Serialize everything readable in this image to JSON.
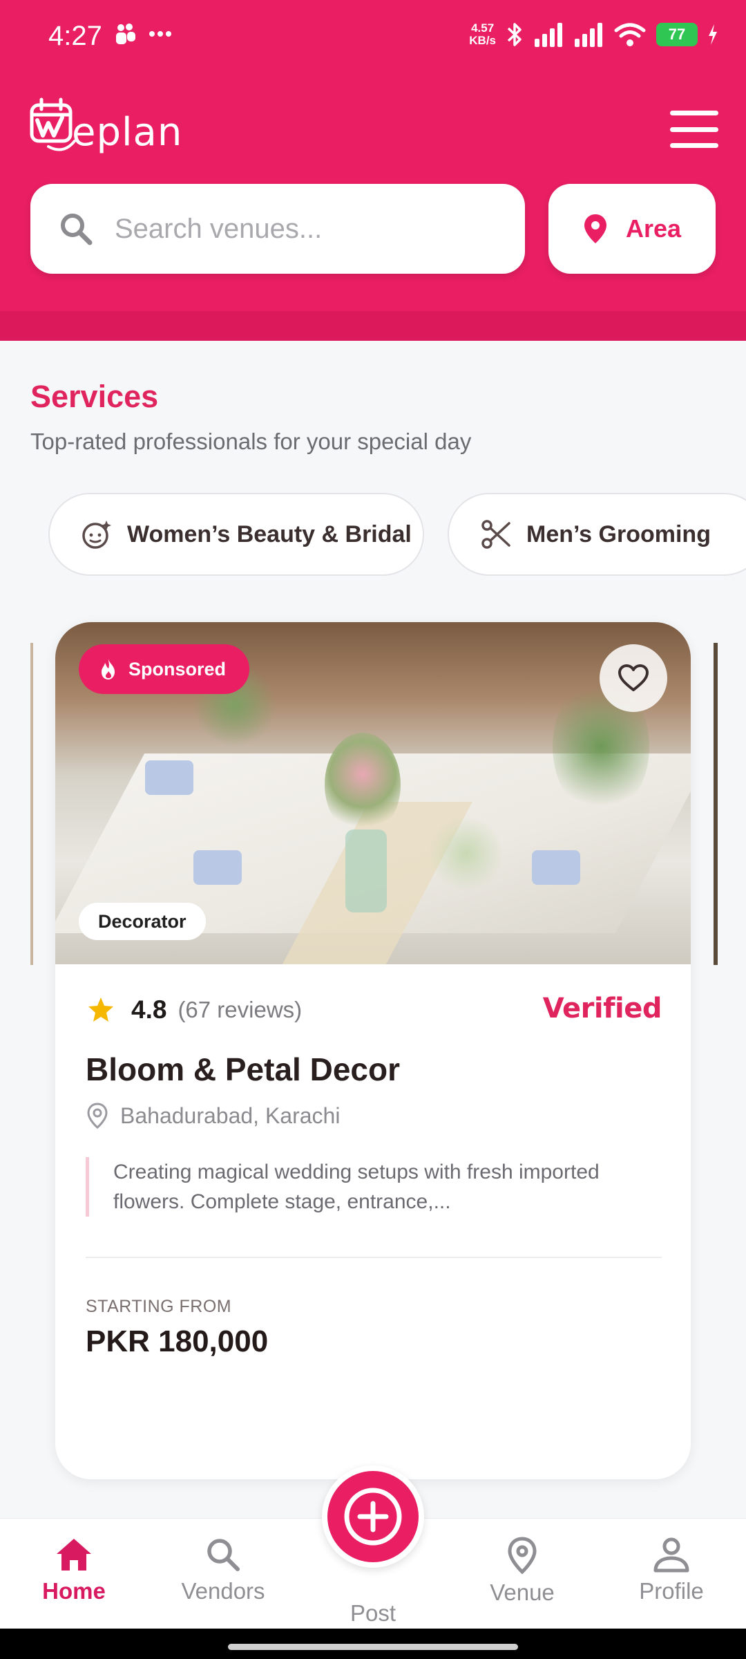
{
  "status_bar": {
    "time": "4:27",
    "net_speed_value": "4.57",
    "net_speed_unit": "KB/s",
    "battery": "77"
  },
  "header": {
    "logo_text": "eplan",
    "search_placeholder": "Search venues...",
    "area_label": "Area",
    "accent_color": "#e91e63"
  },
  "services": {
    "title": "Services",
    "subtitle": "Top-rated professionals for your special day",
    "chips": [
      {
        "label": "Women’s Beauty & Bridal",
        "icon": "face-sparkle-icon"
      },
      {
        "label": "Men’s Grooming",
        "icon": "scissors-icon"
      }
    ]
  },
  "card": {
    "sponsored_label": "Sponsored",
    "category": "Decorator",
    "rating": "4.8",
    "reviews": "(67 reviews)",
    "verified_label": "Verified",
    "name": "Bloom & Petal Decor",
    "location": "Bahadurabad, Karachi",
    "description": "Creating magical wedding setups with fresh imported flowers. Complete stage, entrance,...",
    "starting_label": "STARTING FROM",
    "price": "PKR 180,000"
  },
  "nav": {
    "home": "Home",
    "vendors": "Vendors",
    "post": "Post",
    "venue": "Venue",
    "profile": "Profile"
  }
}
